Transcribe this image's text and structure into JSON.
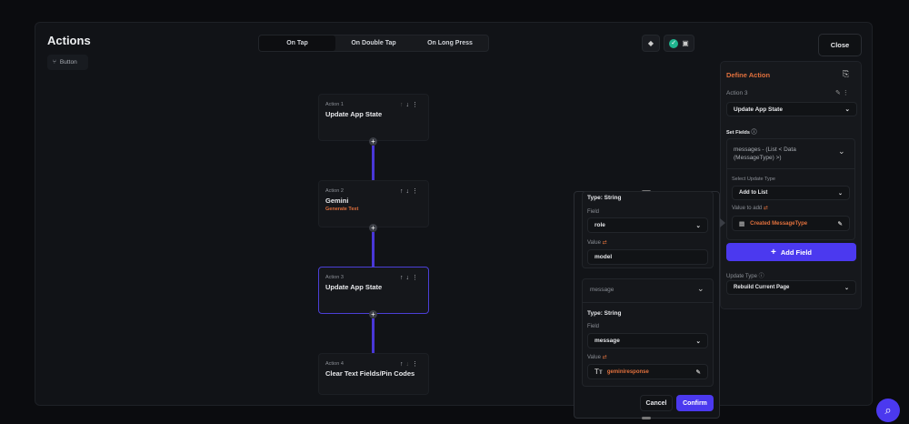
{
  "header": {
    "title": "Actions",
    "widget_chip": "Button",
    "close_label": "Close"
  },
  "tabs": [
    {
      "label": "On Tap",
      "active": true
    },
    {
      "label": "On Double Tap",
      "active": false
    },
    {
      "label": "On Long Press",
      "active": false
    }
  ],
  "actions": [
    {
      "label": "Action 1",
      "name": "Update App State",
      "sub": ""
    },
    {
      "label": "Action 2",
      "name": "Gemini",
      "sub": "Generate Text"
    },
    {
      "label": "Action 3",
      "name": "Update App State",
      "sub": "",
      "selected": true
    },
    {
      "label": "Action 4",
      "name": "Clear Text Fields/Pin Codes",
      "sub": ""
    }
  ],
  "define": {
    "title": "Define Action",
    "action_label": "Action 3",
    "action_type": "Update App State",
    "set_fields_label": "Set Fields",
    "field": "messages - (List < Data (MessageType) >)",
    "update_type_select_label": "Select Update Type",
    "update_type_select": "Add to List",
    "value_to_add_label": "Value to add",
    "value_to_add": "Created MessageType",
    "add_field": "Add Field",
    "update_type_label": "Update Type",
    "update_type": "Rebuild Current Page"
  },
  "popup": {
    "field1": {
      "type": "Type: String",
      "field_label": "Field",
      "field": "role",
      "value_label": "Value",
      "value": "model"
    },
    "field2": {
      "header": "message",
      "type": "Type: String",
      "field_label": "Field",
      "field": "message",
      "value_label": "Value",
      "value": "geminiresponse"
    },
    "cancel": "Cancel",
    "confirm": "Confirm"
  },
  "colors": {
    "accent": "#4b39ef",
    "orange": "#e0703d",
    "check": "#1fb58f"
  }
}
